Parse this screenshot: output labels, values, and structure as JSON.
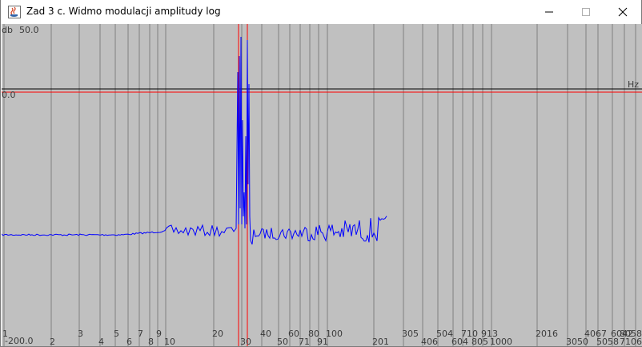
{
  "window": {
    "title": "Zad 3 c. Widmo modulacji amplitudy log",
    "buttons": {
      "minimize": "minimize",
      "maximize": "maximize",
      "close": "close"
    }
  },
  "plot": {
    "y_unit": "db",
    "y_max_label": "50.0",
    "y_zero_label": "0.0",
    "y_min_label": "-200.0",
    "x_unit": "Hz",
    "colors": {
      "background": "#c0c0c0",
      "grid": "#808080",
      "cursor": "#ff0000",
      "axis": "#000000",
      "signal": "#0000ff"
    },
    "x_tick_labels": [
      "1",
      "2",
      "3",
      "4",
      "5",
      "6",
      "7",
      "8",
      "9",
      "10",
      "20",
      "30",
      "40",
      "50",
      "60",
      "71",
      "80",
      "91",
      "100",
      "201",
      "305",
      "406",
      "504",
      "604",
      "710",
      "805",
      "913",
      "1000",
      "2016",
      "3050",
      "4067",
      "5058",
      "6042",
      "7106",
      "8058"
    ]
  },
  "chart_data": {
    "type": "line",
    "x_scale": "log",
    "xlabel": "Hz",
    "ylabel": "db",
    "ylim": [
      -200,
      50
    ],
    "series": [
      {
        "values_description_free": true,
        "x": [
          1,
          2,
          3,
          5,
          8,
          10,
          12,
          14,
          16,
          18,
          20,
          22,
          25,
          27,
          28,
          29,
          30,
          31,
          32,
          33,
          34,
          35,
          40,
          50,
          60,
          80,
          100,
          150,
          201,
          250
        ],
        "y": [
          -155,
          -156,
          -157,
          -157,
          -155,
          -152,
          -148,
          -150,
          -147,
          -152,
          -149,
          -148,
          -146,
          -140,
          20,
          -60,
          -10,
          -40,
          20,
          -30,
          -150,
          -148,
          -147,
          -145,
          -143,
          -140,
          -142,
          -138,
          -137,
          -136
        ]
      }
    ]
  }
}
